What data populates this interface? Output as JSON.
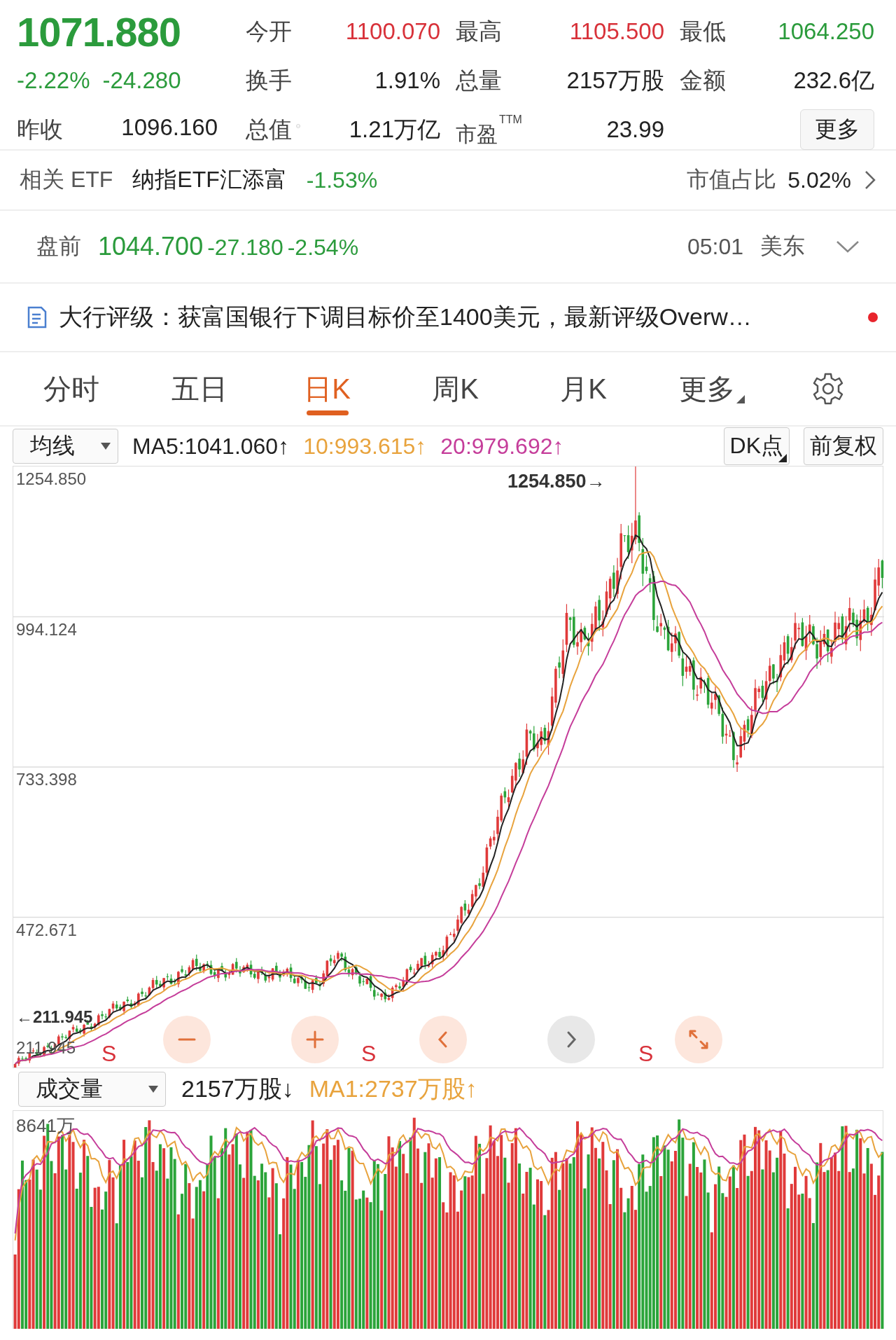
{
  "quote": {
    "price": "1071.880",
    "change_pct": "-2.22%",
    "change": "-24.280",
    "color": "#2b9b3c",
    "prev_close": {
      "label": "昨收",
      "value": "1096.160"
    },
    "stats": [
      {
        "label": "今开",
        "value": "1100.070",
        "color": "#d8323a"
      },
      {
        "label": "最高",
        "value": "1105.500",
        "color": "#d8323a"
      },
      {
        "label": "最低",
        "value": "1064.250",
        "color": "#2b9b3c"
      },
      {
        "label": "换手",
        "value": "1.91%",
        "color": "#222222"
      },
      {
        "label": "总量",
        "value": "2157万股",
        "color": "#222222"
      },
      {
        "label": "金额",
        "value": "232.6亿",
        "color": "#222222"
      },
      {
        "label": "总值",
        "value": "1.21万亿",
        "color": "#222222"
      },
      {
        "label": "市盈",
        "sup": "TTM",
        "value": "23.99",
        "color": "#222222"
      }
    ],
    "more_button": "更多"
  },
  "etf": {
    "label": "相关 ETF",
    "name": "纳指ETF汇添富",
    "change": "-1.53%",
    "share_label": "市值占比",
    "share": "5.02%"
  },
  "premarket": {
    "label": "盘前",
    "price": "1044.700",
    "change": "-27.180",
    "change_pct": "-2.54%",
    "time": "05:01",
    "zone": "美东",
    "expanded": false
  },
  "news": {
    "text": "大行评级：获富国银行下调目标价至1400美元，最新评级Overw…",
    "unread": true
  },
  "tabs": [
    {
      "label": "分时",
      "selected": false,
      "kind": "tab"
    },
    {
      "label": "五日",
      "selected": false,
      "kind": "tab"
    },
    {
      "label": "日K",
      "selected": true,
      "kind": "tab"
    },
    {
      "label": "周K",
      "selected": false,
      "kind": "tab"
    },
    {
      "label": "月K",
      "selected": false,
      "kind": "tab"
    },
    {
      "label": "更多",
      "selected": false,
      "kind": "menu"
    }
  ],
  "legend": {
    "indicator": "均线",
    "ma": [
      {
        "label": "MA5:1041.060↑",
        "color": "#222222"
      },
      {
        "label": "10:993.615↑",
        "color": "#e8a33d"
      },
      {
        "label": "20:979.692↑",
        "color": "#c53d9a"
      }
    ],
    "buttons": [
      "DK点",
      "前复权"
    ]
  },
  "chart": {
    "y_labels": [
      "1254.850",
      "994.124",
      "733.398",
      "472.671",
      "211.945"
    ],
    "high_marker": "1254.850→",
    "low_marker": "←211.945",
    "signals": [
      "S",
      "S",
      "S"
    ],
    "nav_buttons": [
      {
        "kind": "zoom-out",
        "disabled": false
      },
      {
        "kind": "zoom-in",
        "disabled": false
      },
      {
        "kind": "prev",
        "disabled": false
      },
      {
        "kind": "next",
        "disabled": true
      },
      {
        "kind": "fullscreen",
        "disabled": false
      }
    ]
  },
  "volume": {
    "indicator": "成交量",
    "value": "2157万股↓",
    "ma": [
      {
        "label": "MA1:2737万股↑",
        "color": "#e8a33d"
      }
    ],
    "y_label": "8641万"
  }
}
